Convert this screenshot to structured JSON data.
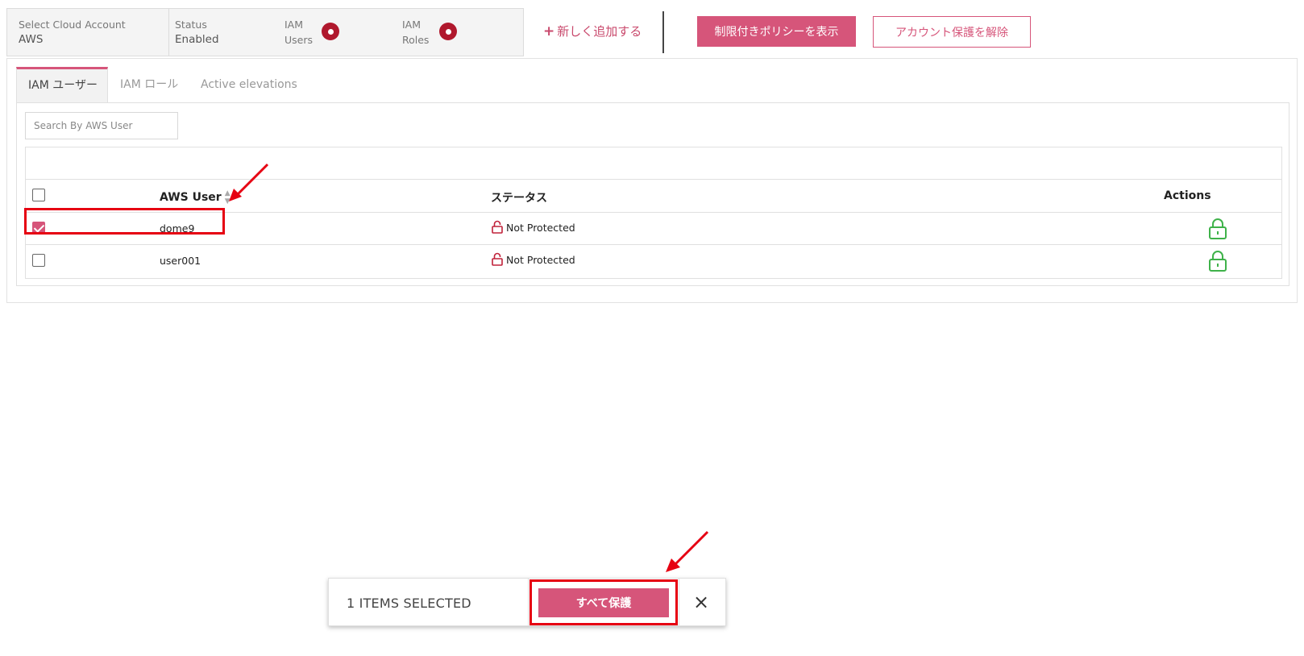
{
  "summary": {
    "cloud_account_label": "Select Cloud Account",
    "cloud_account_value": "AWS",
    "status_label": "Status",
    "status_value": "Enabled",
    "iam_users_label_1": "IAM",
    "iam_users_label_2": "Users",
    "iam_roles_label_1": "IAM",
    "iam_roles_label_2": "Roles"
  },
  "toolbar": {
    "add_new_label": "新しく追加する",
    "show_restricted_policy_label": "制限付きポリシーを表示",
    "unprotect_account_label": "アカウント保護を解除"
  },
  "tabs": [
    {
      "label": "IAM ユーザー",
      "active": true
    },
    {
      "label": "IAM ロール",
      "active": false
    },
    {
      "label": "Active elevations",
      "active": false
    }
  ],
  "search": {
    "placeholder": "Search By AWS User",
    "value": ""
  },
  "table": {
    "columns": {
      "user": "AWS User",
      "status": "ステータス",
      "actions": "Actions"
    },
    "rows": [
      {
        "user": "dome9",
        "status": "Not Protected",
        "checked": true
      },
      {
        "user": "user001",
        "status": "Not Protected",
        "checked": false
      }
    ]
  },
  "selection_bar": {
    "count_text": "1 ITEMS SELECTED",
    "protect_all_label": "すべて保護",
    "close_icon": "×"
  },
  "colors": {
    "accent": "#d6557a",
    "alert_red": "#b0182d",
    "unlocked_red": "#c0223a",
    "lock_green": "#3fb24a",
    "highlight": "#e60012"
  },
  "icons": [
    "plus-icon",
    "red-status-dot-icon",
    "sort-icon",
    "unlocked-icon",
    "lock-icon",
    "close-icon",
    "arrow-annotation-icon"
  ]
}
